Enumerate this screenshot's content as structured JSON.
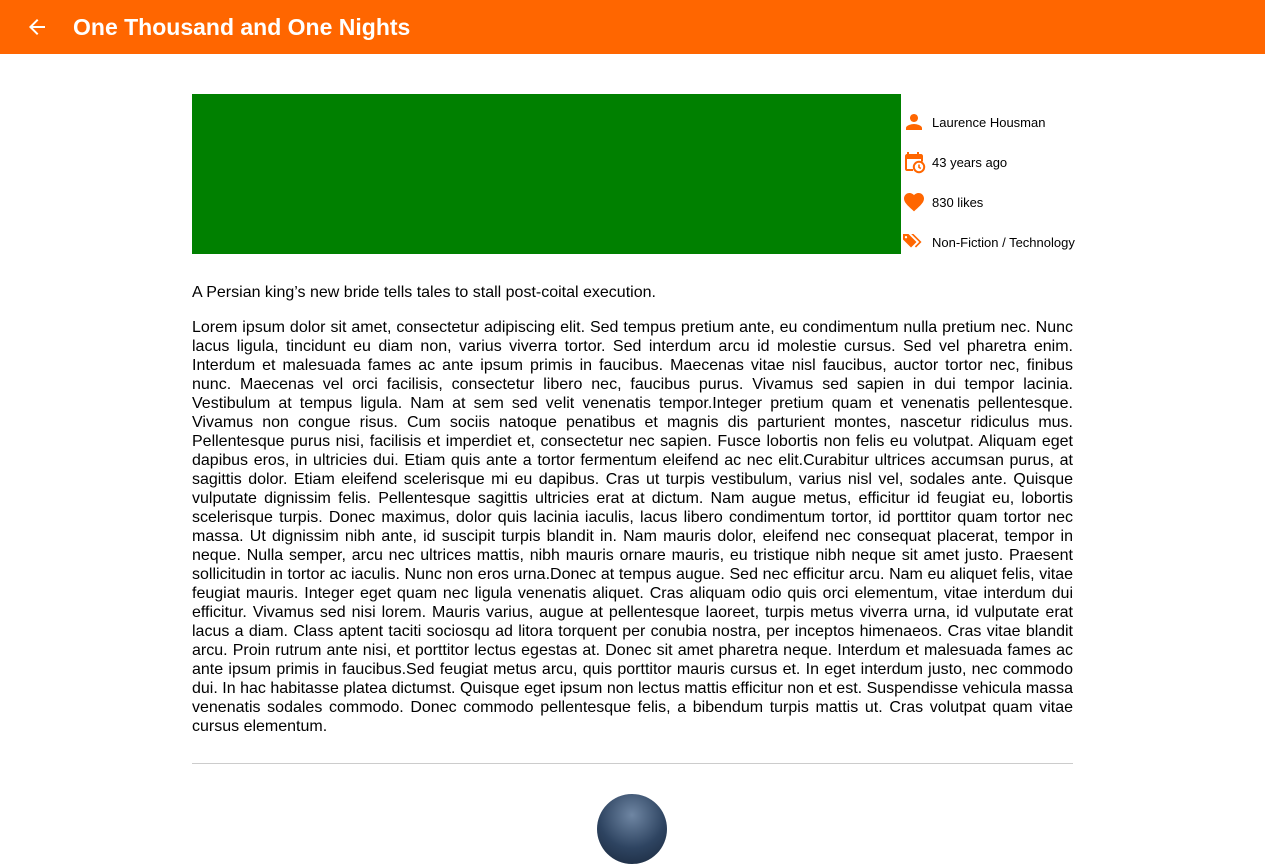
{
  "appbar": {
    "back_icon": "arrow-back-icon",
    "title": "One Thousand and One Nights",
    "color": "#ff6600"
  },
  "book": {
    "cover_color": "#008000",
    "author": "Laurence Housman",
    "published": "43 years ago",
    "likes": "830 likes",
    "genres": "Non-Fiction / Technology",
    "icons": {
      "author": "person-icon",
      "published": "calendar-clock-icon",
      "likes": "heart-icon",
      "genres": "tags-icon"
    },
    "accent_color": "#ff6600",
    "tagline": "A Persian king’s new bride tells tales to stall post-coital execution.",
    "description": "Lorem ipsum dolor sit amet, consectetur adipiscing elit. Sed tempus pretium ante, eu condimentum nulla pretium nec. Nunc lacus ligula, tincidunt eu diam non, varius viverra tortor. Sed interdum arcu id molestie cursus. Sed vel pharetra enim. Interdum et malesuada fames ac ante ipsum primis in faucibus. Maecenas vitae nisl faucibus, auctor tortor nec, finibus nunc. Maecenas vel orci facilisis, consectetur libero nec, faucibus purus. Vivamus sed sapien in dui tempor lacinia. Vestibulum at tempus ligula. Nam at sem sed velit venenatis tempor.Integer pretium quam et venenatis pellentesque. Vivamus non congue risus. Cum sociis natoque penatibus et magnis dis parturient montes, nascetur ridiculus mus. Pellentesque purus nisi, facilisis et imperdiet et, consectetur nec sapien. Fusce lobortis non felis eu volutpat. Aliquam eget dapibus eros, in ultricies dui. Etiam quis ante a tortor fermentum eleifend ac nec elit.Curabitur ultrices accumsan purus, at sagittis dolor. Etiam eleifend scelerisque mi eu dapibus. Cras ut turpis vestibulum, varius nisl vel, sodales ante. Quisque vulputate dignissim felis. Pellentesque sagittis ultricies erat at dictum. Nam augue metus, efficitur id feugiat eu, lobortis scelerisque turpis. Donec maximus, dolor quis lacinia iaculis, lacus libero condimentum tortor, id porttitor quam tortor nec massa. Ut dignissim nibh ante, id suscipit turpis blandit in. Nam mauris dolor, eleifend nec consequat placerat, tempor in neque. Nulla semper, arcu nec ultrices mattis, nibh mauris ornare mauris, eu tristique nibh neque sit amet justo. Praesent sollicitudin in tortor ac iaculis. Nunc non eros urna.Donec at tempus augue. Sed nec efficitur arcu. Nam eu aliquet felis, vitae feugiat mauris. Integer eget quam nec ligula venenatis aliquet. Cras aliquam odio quis orci elementum, vitae interdum dui efficitur. Vivamus sed nisi lorem. Mauris varius, augue at pellentesque laoreet, turpis metus viverra urna, id vulputate erat lacus a diam. Class aptent taciti sociosqu ad litora torquent per conubia nostra, per inceptos himenaeos. Cras vitae blandit arcu. Proin rutrum ante nisi, et porttitor lectus egestas at. Donec sit amet pharetra neque. Interdum et malesuada fames ac ante ipsum primis in faucibus.Sed feugiat metus arcu, quis porttitor mauris cursus et. In eget interdum justo, nec commodo dui. In hac habitasse platea dictumst. Quisque eget ipsum non lectus mattis efficitur non et est. Suspendisse vehicula massa venenatis sodales commodo. Donec commodo pellentesque felis, a bibendum turpis mattis ut. Cras volutpat quam vitae cursus elementum."
  }
}
